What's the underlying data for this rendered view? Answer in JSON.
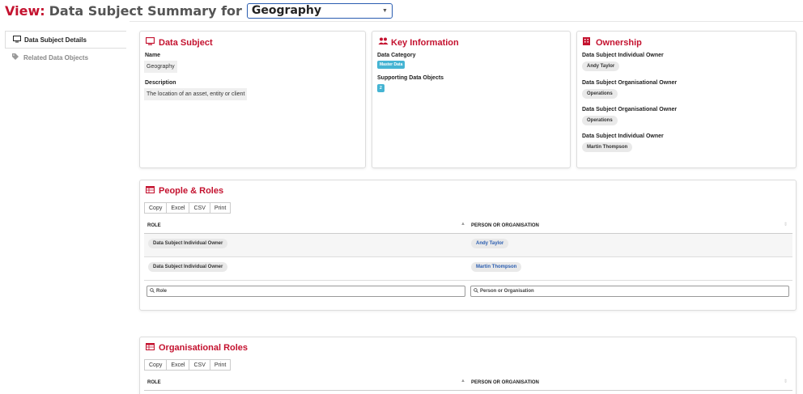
{
  "header": {
    "view_label": "View:",
    "title": "Data Subject Summary for",
    "selected_subject": "Geography"
  },
  "sidenav": {
    "items": [
      {
        "label": "Data Subject Details",
        "icon": "monitor-icon",
        "active": true
      },
      {
        "label": "Related Data Objects",
        "icon": "tag-icon",
        "active": false
      }
    ]
  },
  "data_subject": {
    "title": "Data Subject",
    "name_label": "Name",
    "name_value": "Geography",
    "description_label": "Description",
    "description_value": "The location of an asset, entity or client"
  },
  "key_information": {
    "title": "Key Information",
    "category_label": "Data Category",
    "category_value": "Master Data",
    "supporting_label": "Supporting Data Objects",
    "supporting_count": "2"
  },
  "ownership": {
    "title": "Ownership",
    "entries": [
      {
        "label": "Data Subject Individual Owner",
        "value": "Andy Taylor"
      },
      {
        "label": "Data Subject Organisational Owner",
        "value": "Operations"
      },
      {
        "label": "Data Subject Organisational Owner",
        "value": "Operations"
      },
      {
        "label": "Data Subject Individual Owner",
        "value": "Martin Thompson"
      }
    ]
  },
  "people_roles": {
    "title": "People & Roles",
    "buttons": [
      "Copy",
      "Excel",
      "CSV",
      "Print"
    ],
    "columns": [
      "ROLE",
      "PERSON OR ORGANISATION"
    ],
    "rows": [
      {
        "role": "Data Subject Individual Owner",
        "person": "Andy Taylor"
      },
      {
        "role": "Data Subject Individual Owner",
        "person": "Martin Thompson"
      }
    ],
    "filters": [
      "Role",
      "Person or Organisation"
    ]
  },
  "org_roles": {
    "title": "Organisational Roles",
    "buttons": [
      "Copy",
      "Excel",
      "CSV",
      "Print"
    ],
    "columns": [
      "ROLE",
      "PERSON OR ORGANISATION"
    ]
  },
  "colors": {
    "accent": "#c4122f",
    "link": "#2a5db0",
    "tag": "#45b4d3"
  }
}
